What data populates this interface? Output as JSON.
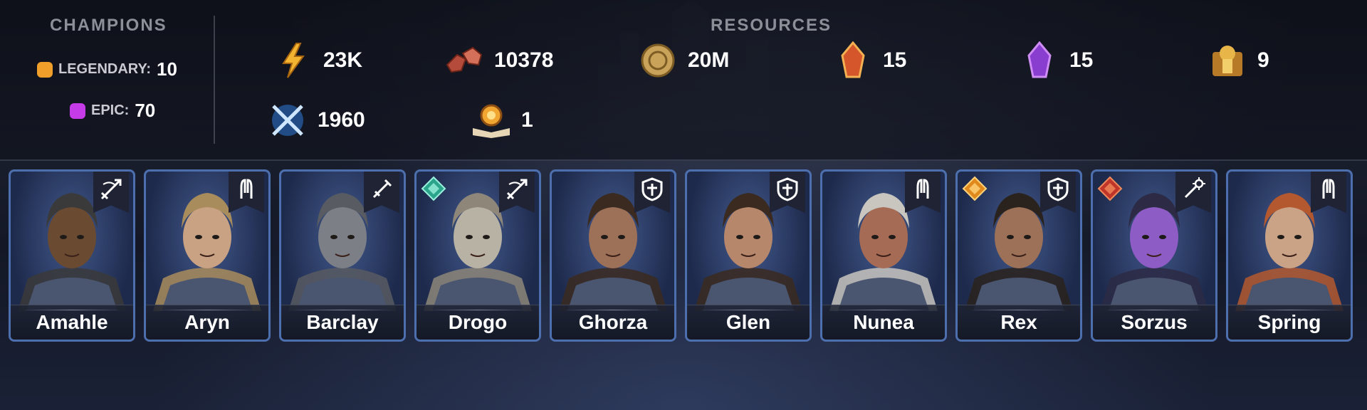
{
  "champions": {
    "title": "CHAMPIONS",
    "legendary": {
      "label": "LEGENDARY:",
      "value": "10",
      "color": "#f0a02a"
    },
    "epic": {
      "label": "EPIC:",
      "value": "70",
      "color": "#c63be8"
    }
  },
  "resources": {
    "title": "RESOURCES",
    "items": [
      {
        "icon": "energy-icon",
        "value": "23K"
      },
      {
        "icon": "ruby-gems-icon",
        "value": "10378"
      },
      {
        "icon": "gold-coin-icon",
        "value": "20M"
      },
      {
        "icon": "force-fragment-icon",
        "value": "15"
      },
      {
        "icon": "magic-fragment-icon",
        "value": "15"
      },
      {
        "icon": "knight-token-icon",
        "value": "9"
      },
      {
        "icon": "crossed-swords-icon",
        "value": "1960"
      },
      {
        "icon": "tome-icon",
        "value": "1"
      }
    ]
  },
  "cards": [
    {
      "name": "Amahle",
      "role": "bow-icon",
      "affinity": null,
      "skin": "#6b4a32",
      "hair": "#3a3a3a"
    },
    {
      "name": "Aryn",
      "role": "support-icon",
      "affinity": null,
      "skin": "#c9a283",
      "hair": "#a98c5c"
    },
    {
      "name": "Barclay",
      "role": "sword-icon",
      "affinity": null,
      "skin": "#7c7f86",
      "hair": "#585b62"
    },
    {
      "name": "Drogo",
      "role": "bow-icon",
      "affinity": "spirit",
      "skin": "#b7b2a4",
      "hair": "#8d8679"
    },
    {
      "name": "Ghorza",
      "role": "shield-icon",
      "affinity": null,
      "skin": "#9d7058",
      "hair": "#3b2a20"
    },
    {
      "name": "Glen",
      "role": "shield-icon",
      "affinity": null,
      "skin": "#b6876b",
      "hair": "#3b2a20"
    },
    {
      "name": "Nunea",
      "role": "support-icon",
      "affinity": null,
      "skin": "#a66b55",
      "hair": "#c9c6c0"
    },
    {
      "name": "Rex",
      "role": "shield-icon",
      "affinity": "force",
      "skin": "#9c7158",
      "hair": "#2a221c"
    },
    {
      "name": "Sorzus",
      "role": "magic-icon",
      "affinity": "magic",
      "skin": "#8d5cc4",
      "hair": "#2c2a44"
    },
    {
      "name": "Spring",
      "role": "support-icon",
      "affinity": null,
      "skin": "#caa286",
      "hair": "#b4592f"
    }
  ]
}
